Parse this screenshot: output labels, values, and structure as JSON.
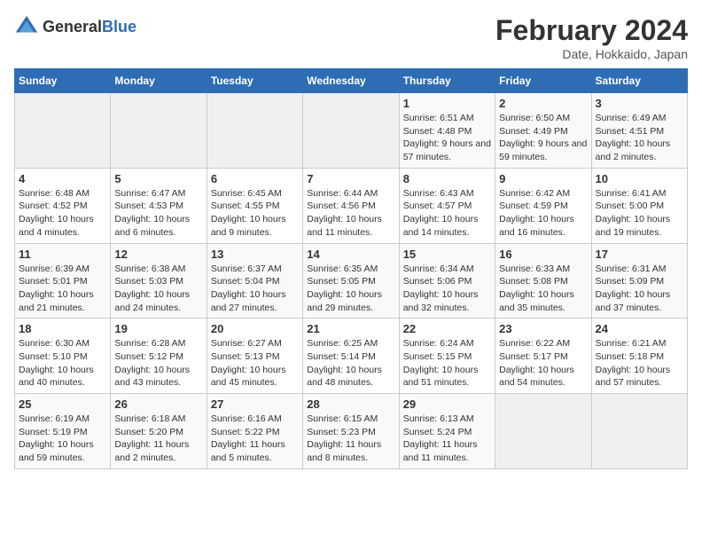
{
  "header": {
    "logo_general": "General",
    "logo_blue": "Blue",
    "title": "February 2024",
    "subtitle": "Date, Hokkaido, Japan"
  },
  "weekdays": [
    "Sunday",
    "Monday",
    "Tuesday",
    "Wednesday",
    "Thursday",
    "Friday",
    "Saturday"
  ],
  "weeks": [
    [
      {
        "day": "",
        "info": ""
      },
      {
        "day": "",
        "info": ""
      },
      {
        "day": "",
        "info": ""
      },
      {
        "day": "",
        "info": ""
      },
      {
        "day": "1",
        "info": "Sunrise: 6:51 AM\nSunset: 4:48 PM\nDaylight: 9 hours and 57 minutes."
      },
      {
        "day": "2",
        "info": "Sunrise: 6:50 AM\nSunset: 4:49 PM\nDaylight: 9 hours and 59 minutes."
      },
      {
        "day": "3",
        "info": "Sunrise: 6:49 AM\nSunset: 4:51 PM\nDaylight: 10 hours and 2 minutes."
      }
    ],
    [
      {
        "day": "4",
        "info": "Sunrise: 6:48 AM\nSunset: 4:52 PM\nDaylight: 10 hours and 4 minutes."
      },
      {
        "day": "5",
        "info": "Sunrise: 6:47 AM\nSunset: 4:53 PM\nDaylight: 10 hours and 6 minutes."
      },
      {
        "day": "6",
        "info": "Sunrise: 6:45 AM\nSunset: 4:55 PM\nDaylight: 10 hours and 9 minutes."
      },
      {
        "day": "7",
        "info": "Sunrise: 6:44 AM\nSunset: 4:56 PM\nDaylight: 10 hours and 11 minutes."
      },
      {
        "day": "8",
        "info": "Sunrise: 6:43 AM\nSunset: 4:57 PM\nDaylight: 10 hours and 14 minutes."
      },
      {
        "day": "9",
        "info": "Sunrise: 6:42 AM\nSunset: 4:59 PM\nDaylight: 10 hours and 16 minutes."
      },
      {
        "day": "10",
        "info": "Sunrise: 6:41 AM\nSunset: 5:00 PM\nDaylight: 10 hours and 19 minutes."
      }
    ],
    [
      {
        "day": "11",
        "info": "Sunrise: 6:39 AM\nSunset: 5:01 PM\nDaylight: 10 hours and 21 minutes."
      },
      {
        "day": "12",
        "info": "Sunrise: 6:38 AM\nSunset: 5:03 PM\nDaylight: 10 hours and 24 minutes."
      },
      {
        "day": "13",
        "info": "Sunrise: 6:37 AM\nSunset: 5:04 PM\nDaylight: 10 hours and 27 minutes."
      },
      {
        "day": "14",
        "info": "Sunrise: 6:35 AM\nSunset: 5:05 PM\nDaylight: 10 hours and 29 minutes."
      },
      {
        "day": "15",
        "info": "Sunrise: 6:34 AM\nSunset: 5:06 PM\nDaylight: 10 hours and 32 minutes."
      },
      {
        "day": "16",
        "info": "Sunrise: 6:33 AM\nSunset: 5:08 PM\nDaylight: 10 hours and 35 minutes."
      },
      {
        "day": "17",
        "info": "Sunrise: 6:31 AM\nSunset: 5:09 PM\nDaylight: 10 hours and 37 minutes."
      }
    ],
    [
      {
        "day": "18",
        "info": "Sunrise: 6:30 AM\nSunset: 5:10 PM\nDaylight: 10 hours and 40 minutes."
      },
      {
        "day": "19",
        "info": "Sunrise: 6:28 AM\nSunset: 5:12 PM\nDaylight: 10 hours and 43 minutes."
      },
      {
        "day": "20",
        "info": "Sunrise: 6:27 AM\nSunset: 5:13 PM\nDaylight: 10 hours and 45 minutes."
      },
      {
        "day": "21",
        "info": "Sunrise: 6:25 AM\nSunset: 5:14 PM\nDaylight: 10 hours and 48 minutes."
      },
      {
        "day": "22",
        "info": "Sunrise: 6:24 AM\nSunset: 5:15 PM\nDaylight: 10 hours and 51 minutes."
      },
      {
        "day": "23",
        "info": "Sunrise: 6:22 AM\nSunset: 5:17 PM\nDaylight: 10 hours and 54 minutes."
      },
      {
        "day": "24",
        "info": "Sunrise: 6:21 AM\nSunset: 5:18 PM\nDaylight: 10 hours and 57 minutes."
      }
    ],
    [
      {
        "day": "25",
        "info": "Sunrise: 6:19 AM\nSunset: 5:19 PM\nDaylight: 10 hours and 59 minutes."
      },
      {
        "day": "26",
        "info": "Sunrise: 6:18 AM\nSunset: 5:20 PM\nDaylight: 11 hours and 2 minutes."
      },
      {
        "day": "27",
        "info": "Sunrise: 6:16 AM\nSunset: 5:22 PM\nDaylight: 11 hours and 5 minutes."
      },
      {
        "day": "28",
        "info": "Sunrise: 6:15 AM\nSunset: 5:23 PM\nDaylight: 11 hours and 8 minutes."
      },
      {
        "day": "29",
        "info": "Sunrise: 6:13 AM\nSunset: 5:24 PM\nDaylight: 11 hours and 11 minutes."
      },
      {
        "day": "",
        "info": ""
      },
      {
        "day": "",
        "info": ""
      }
    ]
  ]
}
